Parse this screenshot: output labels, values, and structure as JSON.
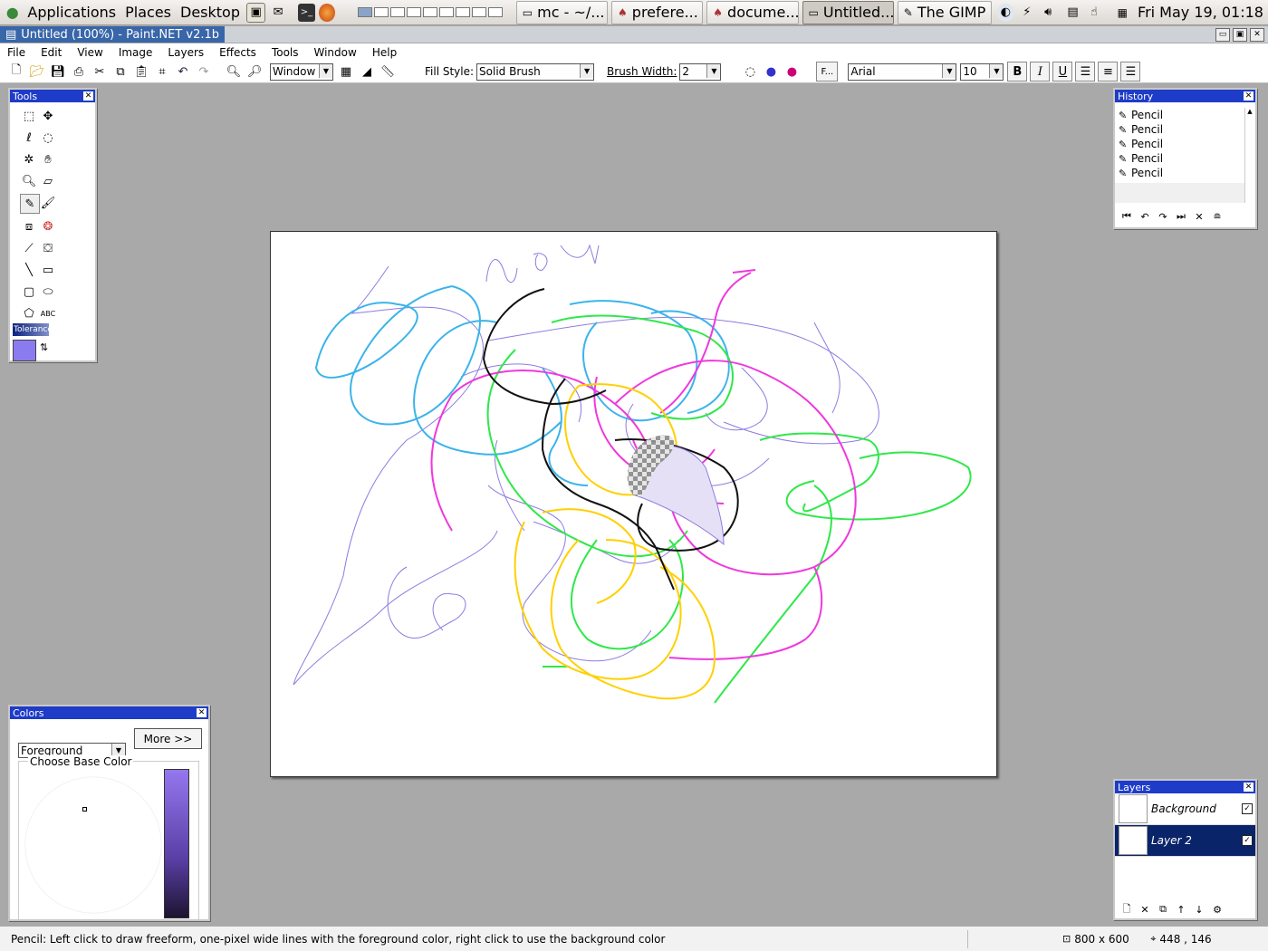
{
  "panel": {
    "menus": [
      "Applications",
      "Places",
      "Desktop"
    ],
    "tasks": [
      {
        "label": "mc - ~/...",
        "icon": "terminal-icon"
      },
      {
        "label": "prefere...",
        "icon": "app-icon"
      },
      {
        "label": "docume...",
        "icon": "app-icon"
      },
      {
        "label": "Untitled...",
        "icon": "window-icon"
      },
      {
        "label": "The GIMP",
        "icon": "gimp-icon"
      }
    ],
    "clock": "Fri May 19, 01:18"
  },
  "window": {
    "title": "Untitled (100%) - Paint.NET v2.1b"
  },
  "menubar": [
    "File",
    "Edit",
    "View",
    "Image",
    "Layers",
    "Effects",
    "Tools",
    "Window",
    "Help"
  ],
  "toolbar": {
    "zoom_value": "Window",
    "fill_style_label": "Fill Style:",
    "fill_style_value": "Solid Brush",
    "brush_width_label": "Brush Width:",
    "brush_width_value": "2",
    "font_button": "F...",
    "font_value": "Arial",
    "font_size_value": "10",
    "bold": "B",
    "italic": "I",
    "underline": "U"
  },
  "tools_panel": {
    "title": "Tools",
    "tolerance_label": "Tolerance",
    "primary_color": "#8a7cf0"
  },
  "history_panel": {
    "title": "History",
    "items": [
      "Pencil",
      "Pencil",
      "Pencil",
      "Pencil",
      "Pencil"
    ]
  },
  "layers_panel": {
    "title": "Layers",
    "layers": [
      {
        "name": "Background",
        "visible": true,
        "selected": false
      },
      {
        "name": "Layer 2",
        "visible": true,
        "selected": true
      }
    ]
  },
  "colors_panel": {
    "title": "Colors",
    "target_value": "Foreground",
    "more_button": "More >>",
    "group_label": "Choose Base Color"
  },
  "canvas": {
    "handwriting": "wow"
  },
  "statusbar": {
    "hint": "Pencil: Left click to draw freeform, one-pixel wide lines with the foreground color, right click to use the background color",
    "image_size": "800 x 600",
    "cursor_pos": "448 , 146"
  }
}
